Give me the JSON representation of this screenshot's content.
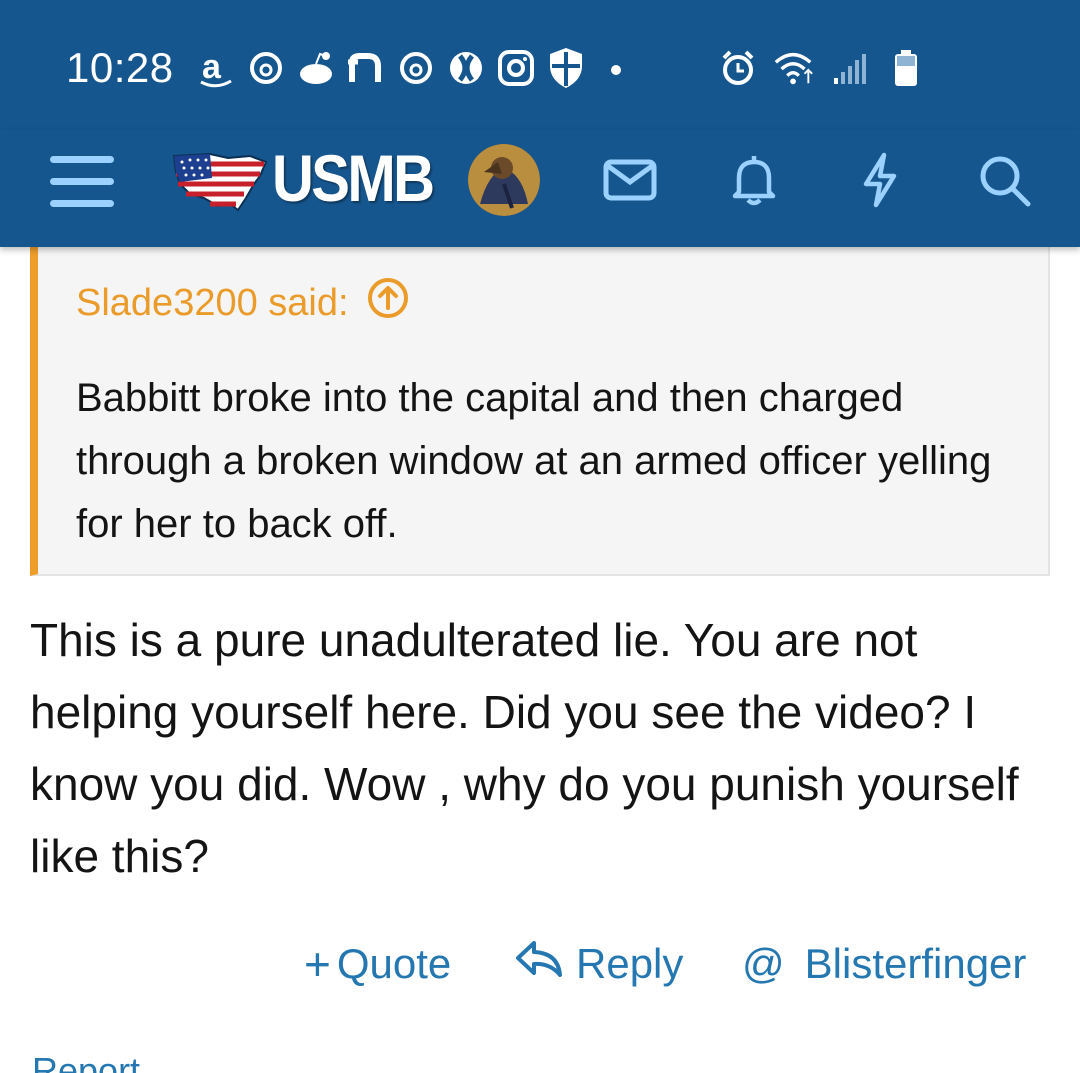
{
  "status_bar": {
    "time": "10:28",
    "left_icons": [
      "amazon-icon",
      "threads-icon",
      "reddit-icon",
      "n-app-icon",
      "threads-icon",
      "opera-icon",
      "instagram-icon",
      "shield-icon",
      "dot-icon"
    ],
    "right_icons": [
      "alarm-icon",
      "wifi-icon",
      "signal-icon",
      "battery-icon"
    ]
  },
  "header": {
    "logo_text": "USMB",
    "icons": [
      "menu-icon",
      "mail-icon",
      "bell-icon",
      "lightning-icon",
      "search-icon"
    ],
    "color": "#16568e",
    "icon_color": "#9bd1ff"
  },
  "quote": {
    "author_said": "Slade3200 said:",
    "body": "Babbitt broke into the capital and then charged through a broken window at an armed officer yelling for her to back off.",
    "accent_color": "#ed9e2a"
  },
  "post": {
    "body": "This is a pure unadulterated lie. You are not helping yourself here. Did you see the video? I know you did. Wow , why do you punish yourself like this?"
  },
  "actions": {
    "quote_prefix": "+",
    "quote_label": "Quote",
    "reply_label": "Reply",
    "mention_prefix": "@",
    "mention_label": "Blisterfinger",
    "report_label": "Report",
    "link_color": "#2577b1"
  }
}
